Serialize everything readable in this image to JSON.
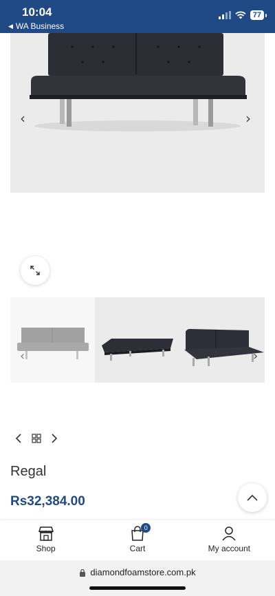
{
  "status_bar": {
    "time": "10:04",
    "back_label": "WA Business",
    "battery": "77"
  },
  "product": {
    "title": "Regal",
    "price": "Rs32,384.00"
  },
  "icons": {
    "prev": "chevron-left-icon",
    "next": "chevron-right-icon",
    "zoom": "expand-icon",
    "grid": "grid-icon",
    "scroll_top": "chevron-up-icon"
  },
  "bottom_nav": {
    "shop_label": "Shop",
    "cart_label": "Cart",
    "cart_count": "0",
    "account_label": "My account"
  },
  "browser": {
    "url": "diamondfoamstore.com.pk"
  },
  "colors": {
    "brand": "#1f4a85",
    "image_bg": "#ebebeb"
  }
}
